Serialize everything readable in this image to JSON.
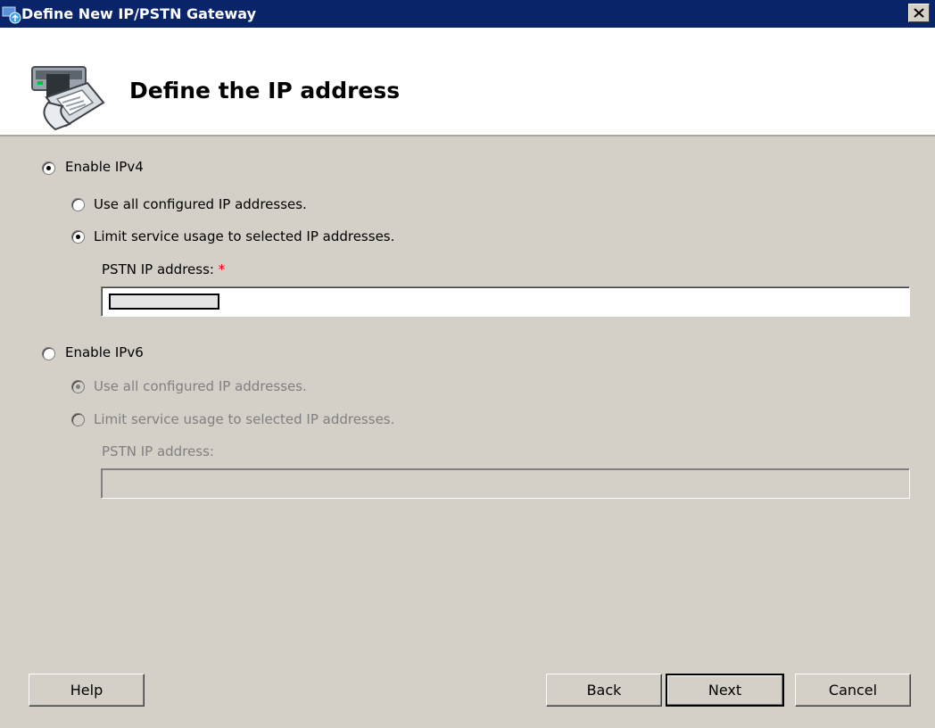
{
  "window": {
    "title": "Define New IP/PSTN Gateway",
    "close_glyph": "×"
  },
  "header": {
    "title": "Define the IP address"
  },
  "ipv4": {
    "enable_label": "Enable IPv4",
    "enabled": true,
    "option_all": "Use all configured IP addresses.",
    "option_limit": "Limit service usage to selected IP addresses.",
    "selected_option": "limit",
    "field_label": "PSTN IP address:",
    "required_marker": "*",
    "field_value": ""
  },
  "ipv6": {
    "enable_label": "Enable IPv6",
    "enabled": false,
    "option_all": "Use all configured IP addresses.",
    "option_limit": "Limit service usage to selected IP addresses.",
    "selected_option": "all",
    "field_label": "PSTN IP address:",
    "field_value": ""
  },
  "buttons": {
    "help": "Help",
    "back": "Back",
    "next": "Next",
    "cancel": "Cancel"
  },
  "icons": {
    "app": "gateway-app-icon",
    "header": "phone-server-icon",
    "close": "close-icon"
  }
}
